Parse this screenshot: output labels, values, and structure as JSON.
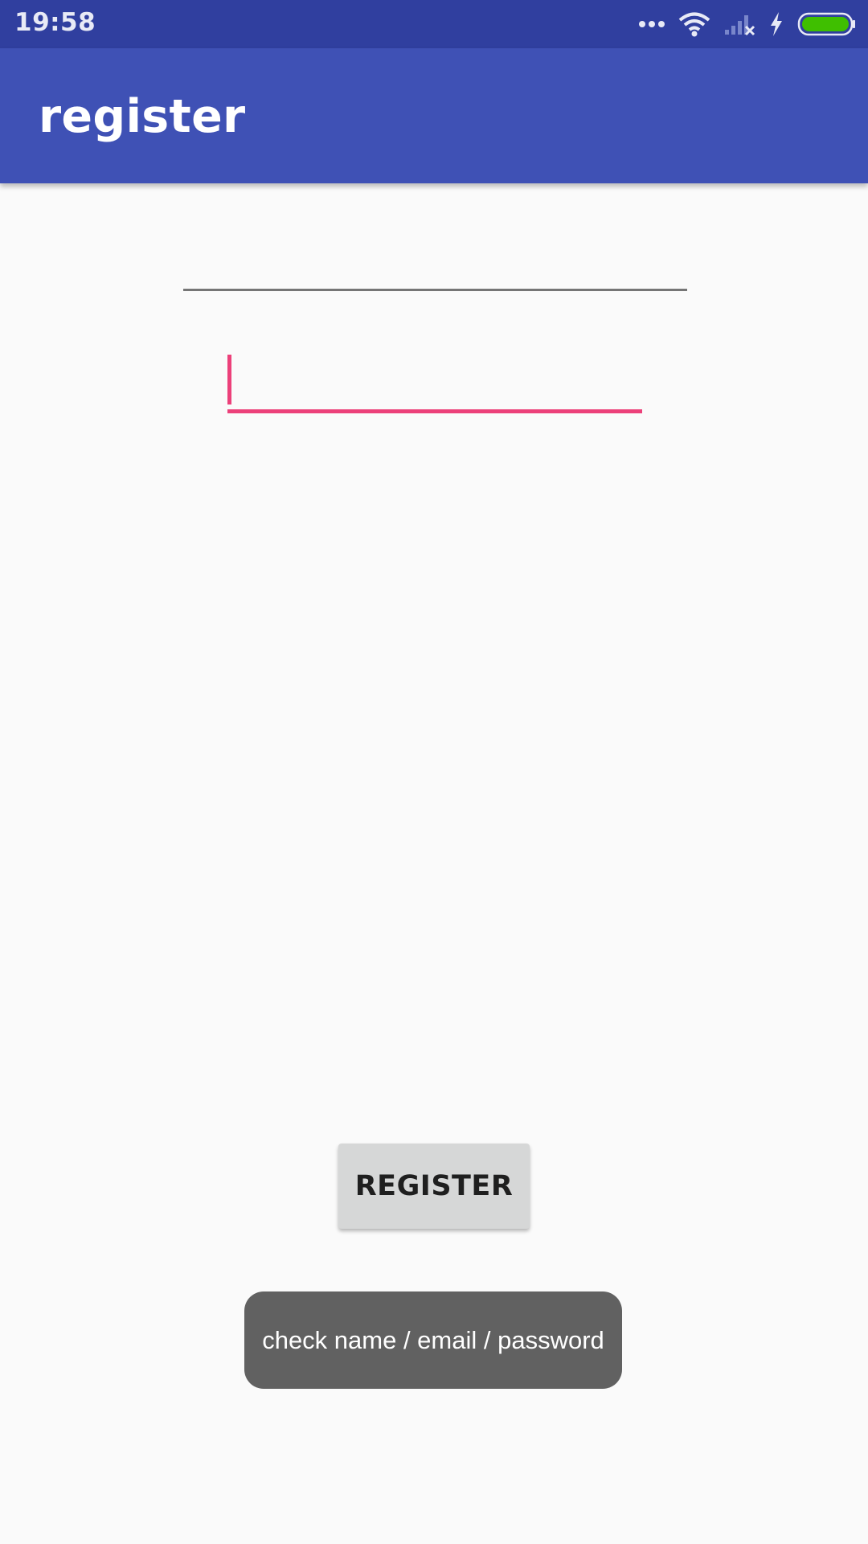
{
  "status_bar": {
    "time": "19:58",
    "icons": [
      "more-dots-icon",
      "wifi-icon",
      "signal-no-service-icon",
      "charging-bolt-icon",
      "battery-full-icon"
    ],
    "battery_color": "#3fbf00"
  },
  "app_bar": {
    "title": "register",
    "color": "#3f51b5"
  },
  "form": {
    "field_1": {
      "value": "",
      "placeholder": ""
    },
    "field_2": {
      "value": "",
      "placeholder": "",
      "focused": true
    },
    "register_label": "REGISTER",
    "accent_color": "#ec407a"
  },
  "toast": {
    "message": "check name / email / password"
  }
}
